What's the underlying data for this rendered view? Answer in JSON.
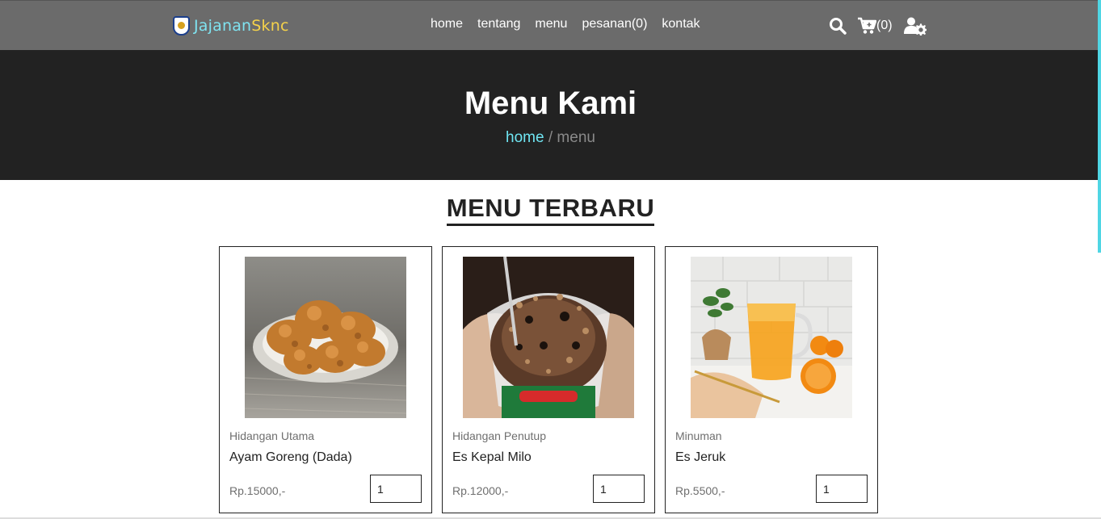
{
  "brand": {
    "part1": "Jajanan",
    "part2": "Sknc",
    "color1": "#7fe3f0",
    "color2": "#f5d24a"
  },
  "nav": {
    "items": [
      {
        "label": "home"
      },
      {
        "label": "tentang"
      },
      {
        "label": "menu"
      },
      {
        "label": "pesanan(0)"
      },
      {
        "label": "kontak"
      }
    ]
  },
  "icons": {
    "search": "search-icon",
    "cart": "cart-icon",
    "cart_count": "(0)",
    "user": "user-settings-icon"
  },
  "hero": {
    "title": "Menu Kami",
    "breadcrumb_home": "home",
    "breadcrumb_sep": " / ",
    "breadcrumb_current": "menu"
  },
  "section": {
    "title": "MENU TERBARU"
  },
  "menu": [
    {
      "category": "Hidangan Utama",
      "name": "Ayam Goreng (Dada)",
      "price": "Rp.15000,-",
      "qty": "1"
    },
    {
      "category": "Hidangan Penutup",
      "name": "Es Kepal Milo",
      "price": "Rp.12000,-",
      "qty": "1"
    },
    {
      "category": "Minuman",
      "name": "Es Jeruk",
      "price": "Rp.5500,-",
      "qty": "1"
    }
  ]
}
